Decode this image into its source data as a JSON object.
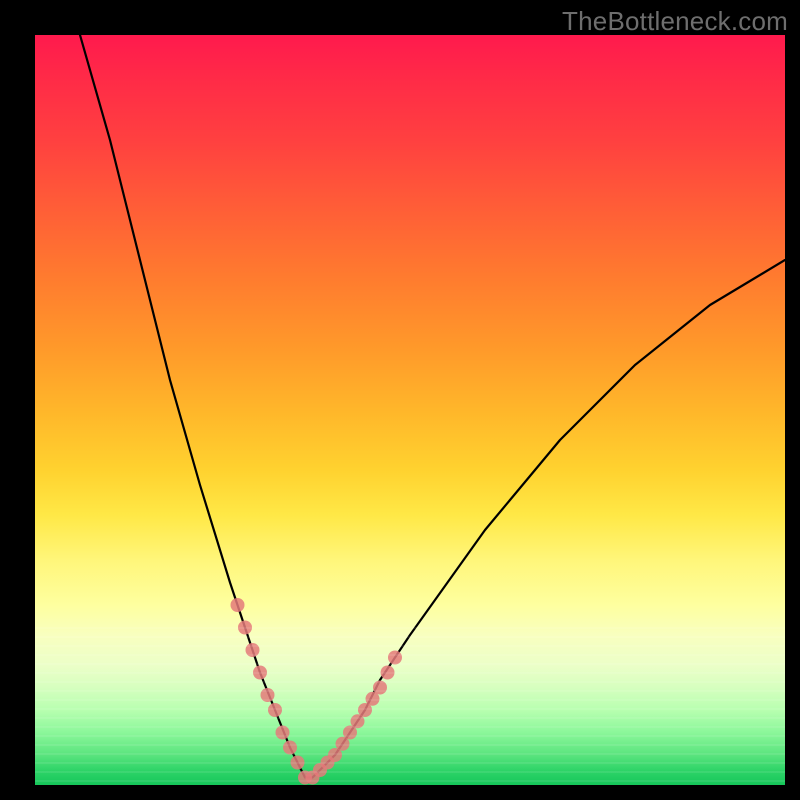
{
  "watermark": "TheBottleneck.com",
  "colors": {
    "frame": "#000000",
    "curve": "#000000",
    "marker": "#e47a7a",
    "gradient_stops": [
      "#ff1a4d",
      "#ff9a2a",
      "#ffe846",
      "#f8ffbf",
      "#2fd468",
      "#16c65a"
    ]
  },
  "chart_data": {
    "type": "line",
    "title": "",
    "xlabel": "",
    "ylabel": "",
    "xlim": [
      0,
      100
    ],
    "ylim": [
      0,
      100
    ],
    "grid": false,
    "series": [
      {
        "name": "curve",
        "note": "approximate V-shaped response; y high at edges, ~0 at x≈36",
        "x": [
          6,
          10,
          14,
          18,
          22,
          26,
          28,
          30,
          32,
          34,
          35,
          36,
          37,
          38,
          40,
          42,
          44,
          46,
          50,
          55,
          60,
          65,
          70,
          75,
          80,
          85,
          90,
          95,
          100
        ],
        "y": [
          100,
          86,
          70,
          54,
          40,
          27,
          21,
          15,
          10,
          5,
          3,
          1,
          1,
          2,
          4,
          7,
          10,
          14,
          20,
          27,
          34,
          40,
          46,
          51,
          56,
          60,
          64,
          67,
          70
        ]
      }
    ],
    "markers": {
      "name": "highlighted-points",
      "note": "salmon beads along the curve near the valley",
      "x": [
        27,
        28,
        29,
        30,
        31,
        32,
        33,
        34,
        35,
        36,
        37,
        38,
        39,
        40,
        41,
        42,
        43,
        44,
        45,
        46,
        47,
        48
      ],
      "y": [
        24,
        21,
        18,
        15,
        12,
        10,
        7,
        5,
        3,
        1,
        1,
        2,
        3,
        4,
        5.5,
        7,
        8.5,
        10,
        11.5,
        13,
        15,
        17
      ]
    }
  }
}
